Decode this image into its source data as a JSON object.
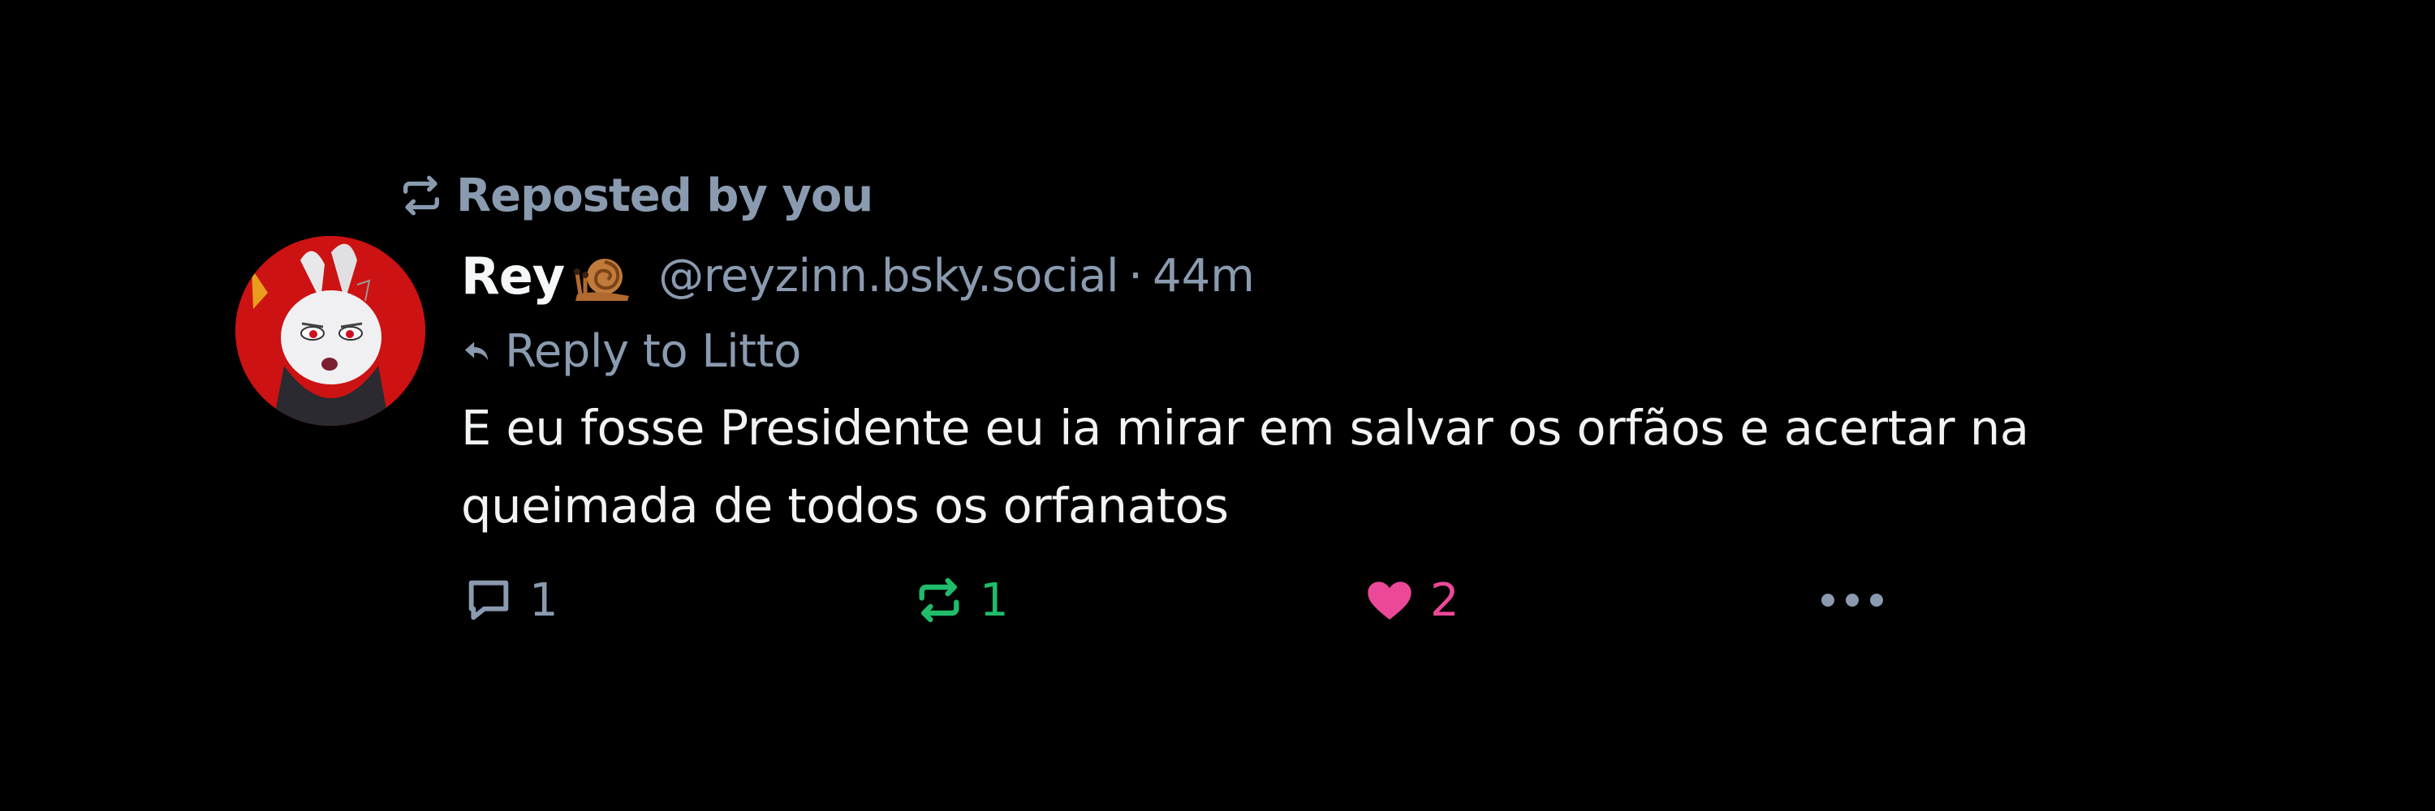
{
  "post": {
    "repost_label": "Reposted by you",
    "author": {
      "display_name": "Rey",
      "emoji": "snail-emoji",
      "handle": "@reyzinn.bsky.social",
      "separator": "·",
      "timestamp": "44m"
    },
    "reply_to": "Reply to Litto",
    "text": "E eu fosse Presidente eu ia mirar em salvar os orfãos e acertar na queimada de todos os orfanatos",
    "actions": {
      "reply_count": "1",
      "repost_count": "1",
      "like_count": "2"
    },
    "icons": {
      "repost_header": "repost-icon",
      "reply_arrow": "reply-arrow-icon",
      "reply": "comment-icon",
      "repost": "repost-icon",
      "like": "heart-icon",
      "more": "more-options-icon"
    }
  },
  "colors": {
    "background": "#000000",
    "muted_text": "#8a9bb0",
    "primary_text": "#f1f3f5",
    "repost_active": "#20bc6a",
    "like_active": "#ec4899"
  }
}
